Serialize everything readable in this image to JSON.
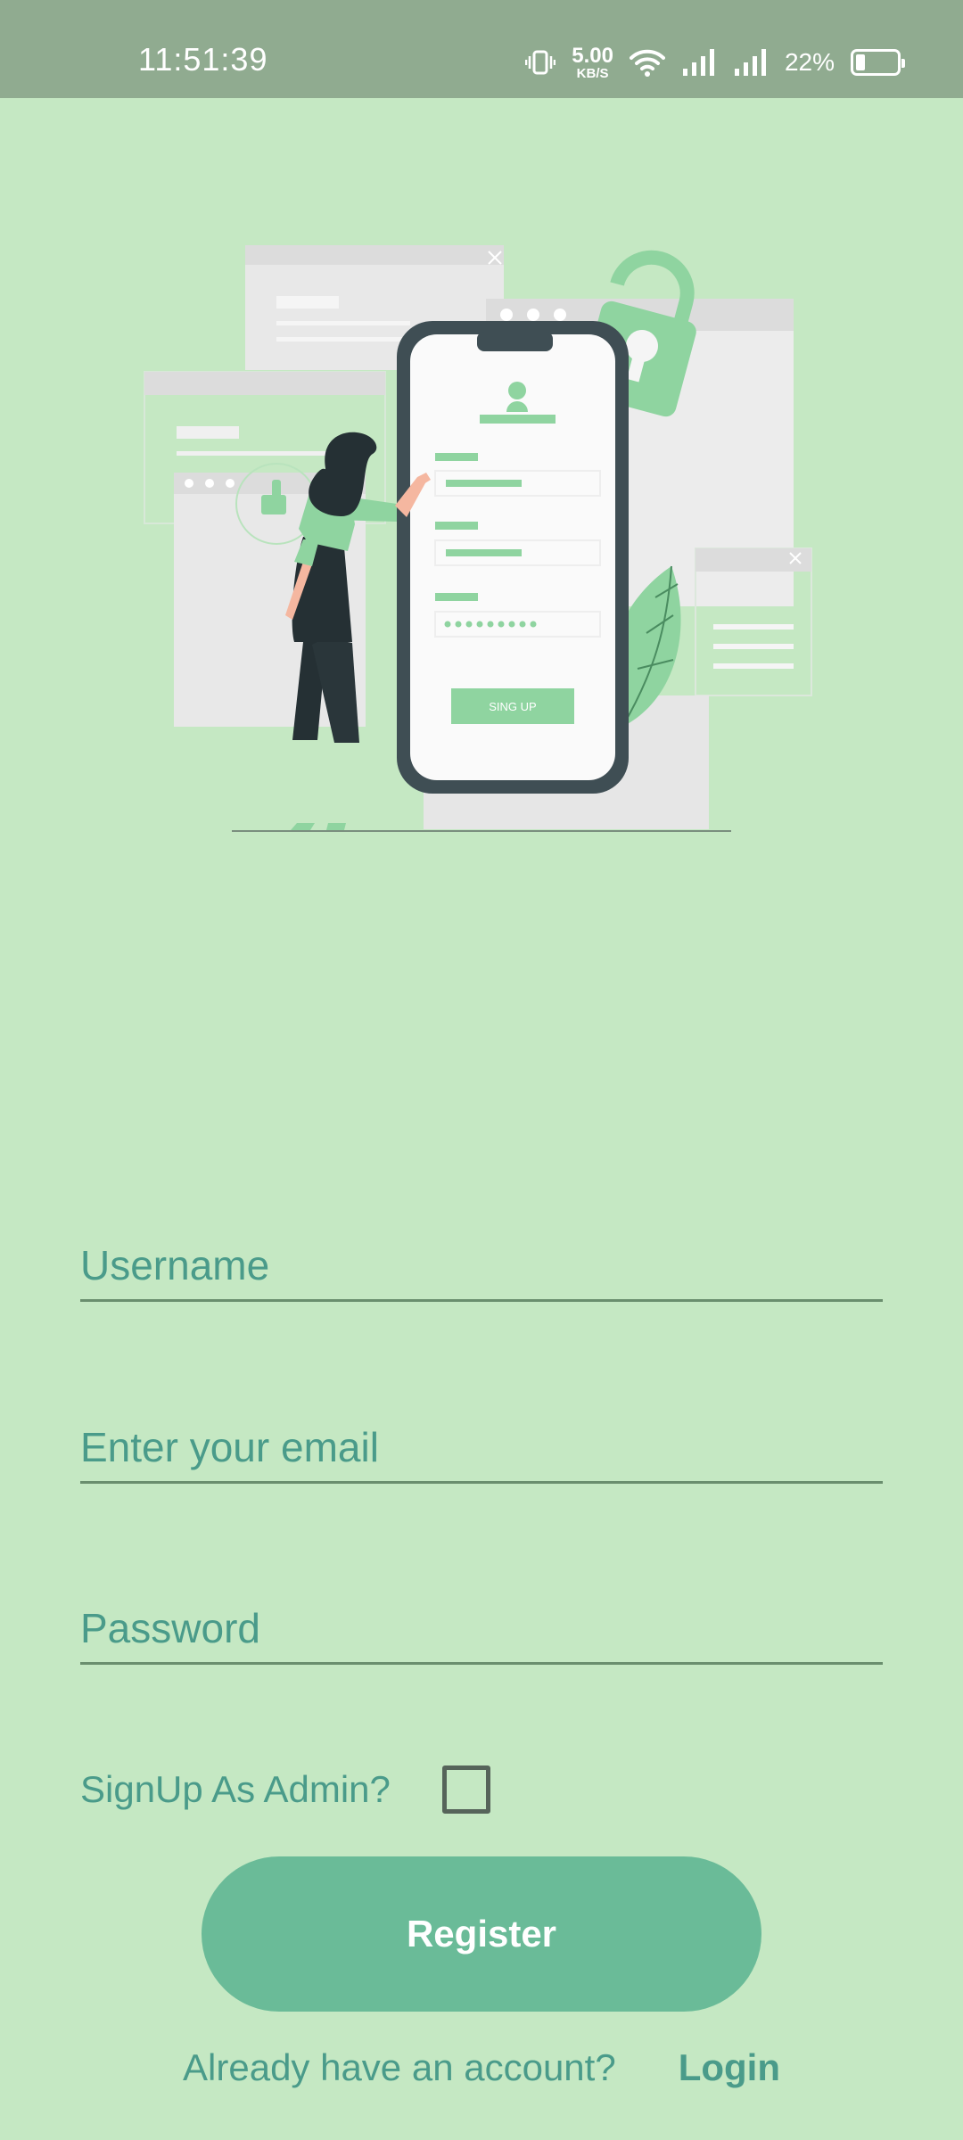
{
  "status_bar": {
    "time": "11:51:39",
    "net_speed_value": "5.00",
    "net_speed_unit": "KB/S",
    "battery_percent": "22%",
    "icons": [
      "vibrate-icon",
      "wifi-icon",
      "signal-icon",
      "signal-icon",
      "battery-icon"
    ]
  },
  "illustration": {
    "button_label": "SING UP"
  },
  "form": {
    "username_placeholder": "Username",
    "email_placeholder": "Enter your email",
    "password_placeholder": "Password",
    "admin_label": "SignUp As Admin?",
    "admin_checked": false
  },
  "actions": {
    "register_label": "Register",
    "login_prompt": "Already have an account?",
    "login_label": "Login"
  },
  "colors": {
    "background": "#c5e8c3",
    "status_bar": "#90ab90",
    "accent": "#6abb98",
    "text_accent": "#4a9b8a"
  }
}
